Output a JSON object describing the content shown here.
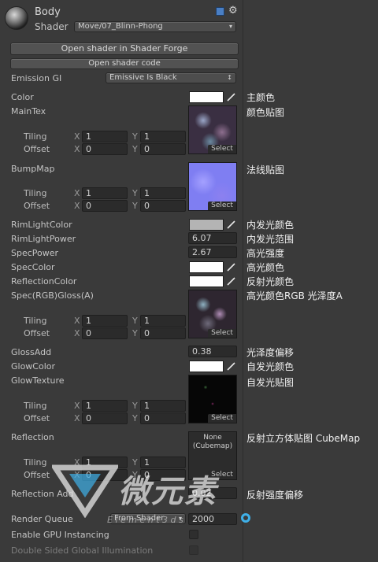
{
  "header": {
    "material_name": "Body",
    "shader_label": "Shader",
    "shader_value": "Move/07_Blinn-Phong"
  },
  "buttons": {
    "open_forge": "Open shader in Shader Forge",
    "open_code": "Open shader code"
  },
  "emission_gi": {
    "label": "Emission GI",
    "value": "Emissive Is Black"
  },
  "axis": {
    "x": "X",
    "y": "Y"
  },
  "sub_labels": {
    "tiling": "Tiling",
    "offset": "Offset"
  },
  "select_label": "Select",
  "properties": {
    "color": {
      "label": "Color",
      "note": "主颜色",
      "swatch": "#ffffff"
    },
    "maintex": {
      "label": "MainTex",
      "note": "颜色贴图",
      "tiling_x": "1",
      "tiling_y": "1",
      "offset_x": "0",
      "offset_y": "0"
    },
    "bumpmap": {
      "label": "BumpMap",
      "note": "法线贴图",
      "tiling_x": "1",
      "tiling_y": "1",
      "offset_x": "0",
      "offset_y": "0"
    },
    "rimlightcolor": {
      "label": "RimLightColor",
      "note": "内发光颜色",
      "swatch": "#b4b4b4"
    },
    "rimlightpower": {
      "label": "RimLightPower",
      "note": "内发光范围",
      "value": "6.07"
    },
    "specpower": {
      "label": "SpecPower",
      "note": "高光强度",
      "value": "2.67"
    },
    "speccolor": {
      "label": "SpecColor",
      "note": "高光颜色",
      "swatch": "#ffffff"
    },
    "reflectioncolor": {
      "label": "ReflectionColor",
      "note": "反射光颜色",
      "swatch": "#ffffff"
    },
    "specgloss": {
      "label": "Spec(RGB)Gloss(A)",
      "note": "高光颜色RGB 光泽度A",
      "tiling_x": "1",
      "tiling_y": "1",
      "offset_x": "0",
      "offset_y": "0"
    },
    "glossadd": {
      "label": "GlossAdd",
      "note": "光泽度偏移",
      "value": "0.38"
    },
    "glowcolor": {
      "label": "GlowColor",
      "note": "自发光颜色",
      "swatch": "#ffffff"
    },
    "glowtexture": {
      "label": "GlowTexture",
      "note": "自发光贴图",
      "tiling_x": "1",
      "tiling_y": "1",
      "offset_x": "0",
      "offset_y": "0"
    },
    "reflection": {
      "label": "Reflection",
      "note": "反射立方体贴图 CubeMap",
      "placeholder": "None\n(Cubemap)",
      "tiling_x": "1",
      "tiling_y": "1",
      "offset_x": "0",
      "offset_y": "0"
    },
    "reflectionadd": {
      "label": "Reflection Add",
      "note": "反射强度偏移",
      "value": "0.02"
    }
  },
  "footer": {
    "render_queue_label": "Render Queue",
    "render_queue_mode": "From Shader",
    "render_queue_value": "2000",
    "gpu_instancing_label": "Enable GPU Instancing",
    "double_sided_label": "Double Sided Global Illumination"
  },
  "watermark": {
    "text": "微元素",
    "sub": "E l e m e n t 3 d s"
  }
}
